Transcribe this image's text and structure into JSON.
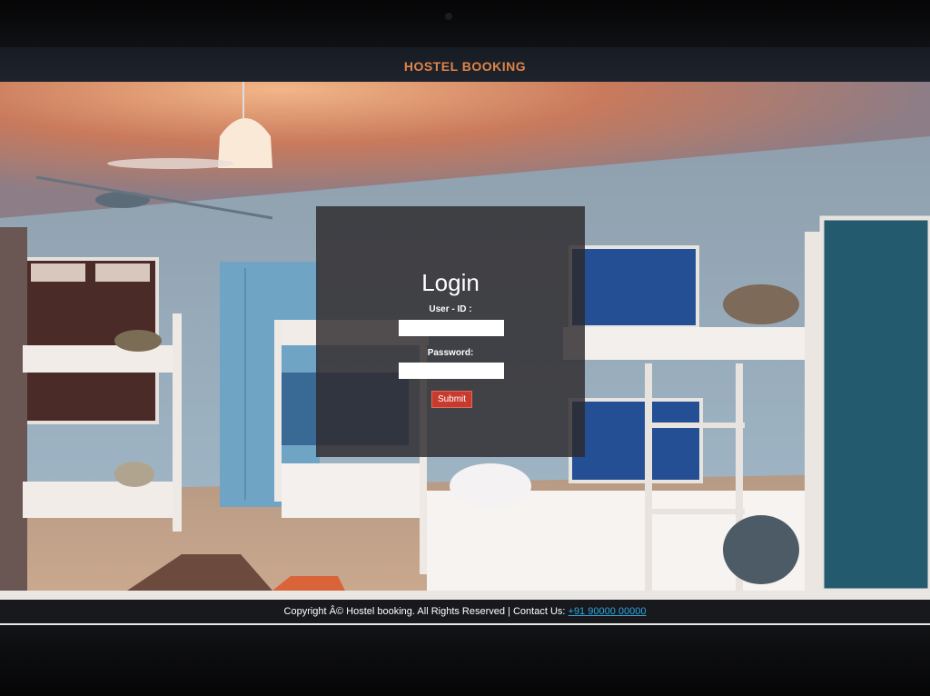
{
  "header": {
    "title": "HOSTEL BOOKING"
  },
  "login": {
    "title": "Login",
    "user_id_label": "User - ID :",
    "user_id_value": "",
    "password_label": "Password:",
    "password_value": "",
    "submit_label": "Submit"
  },
  "footer": {
    "text": "Copyright Â© Hostel booking. All Rights Reserved | Contact Us: ",
    "phone": "+91 90000 00000"
  },
  "colors": {
    "accent": "#e0844a",
    "submit": "#c73a2e",
    "link": "#2ea7e0"
  }
}
